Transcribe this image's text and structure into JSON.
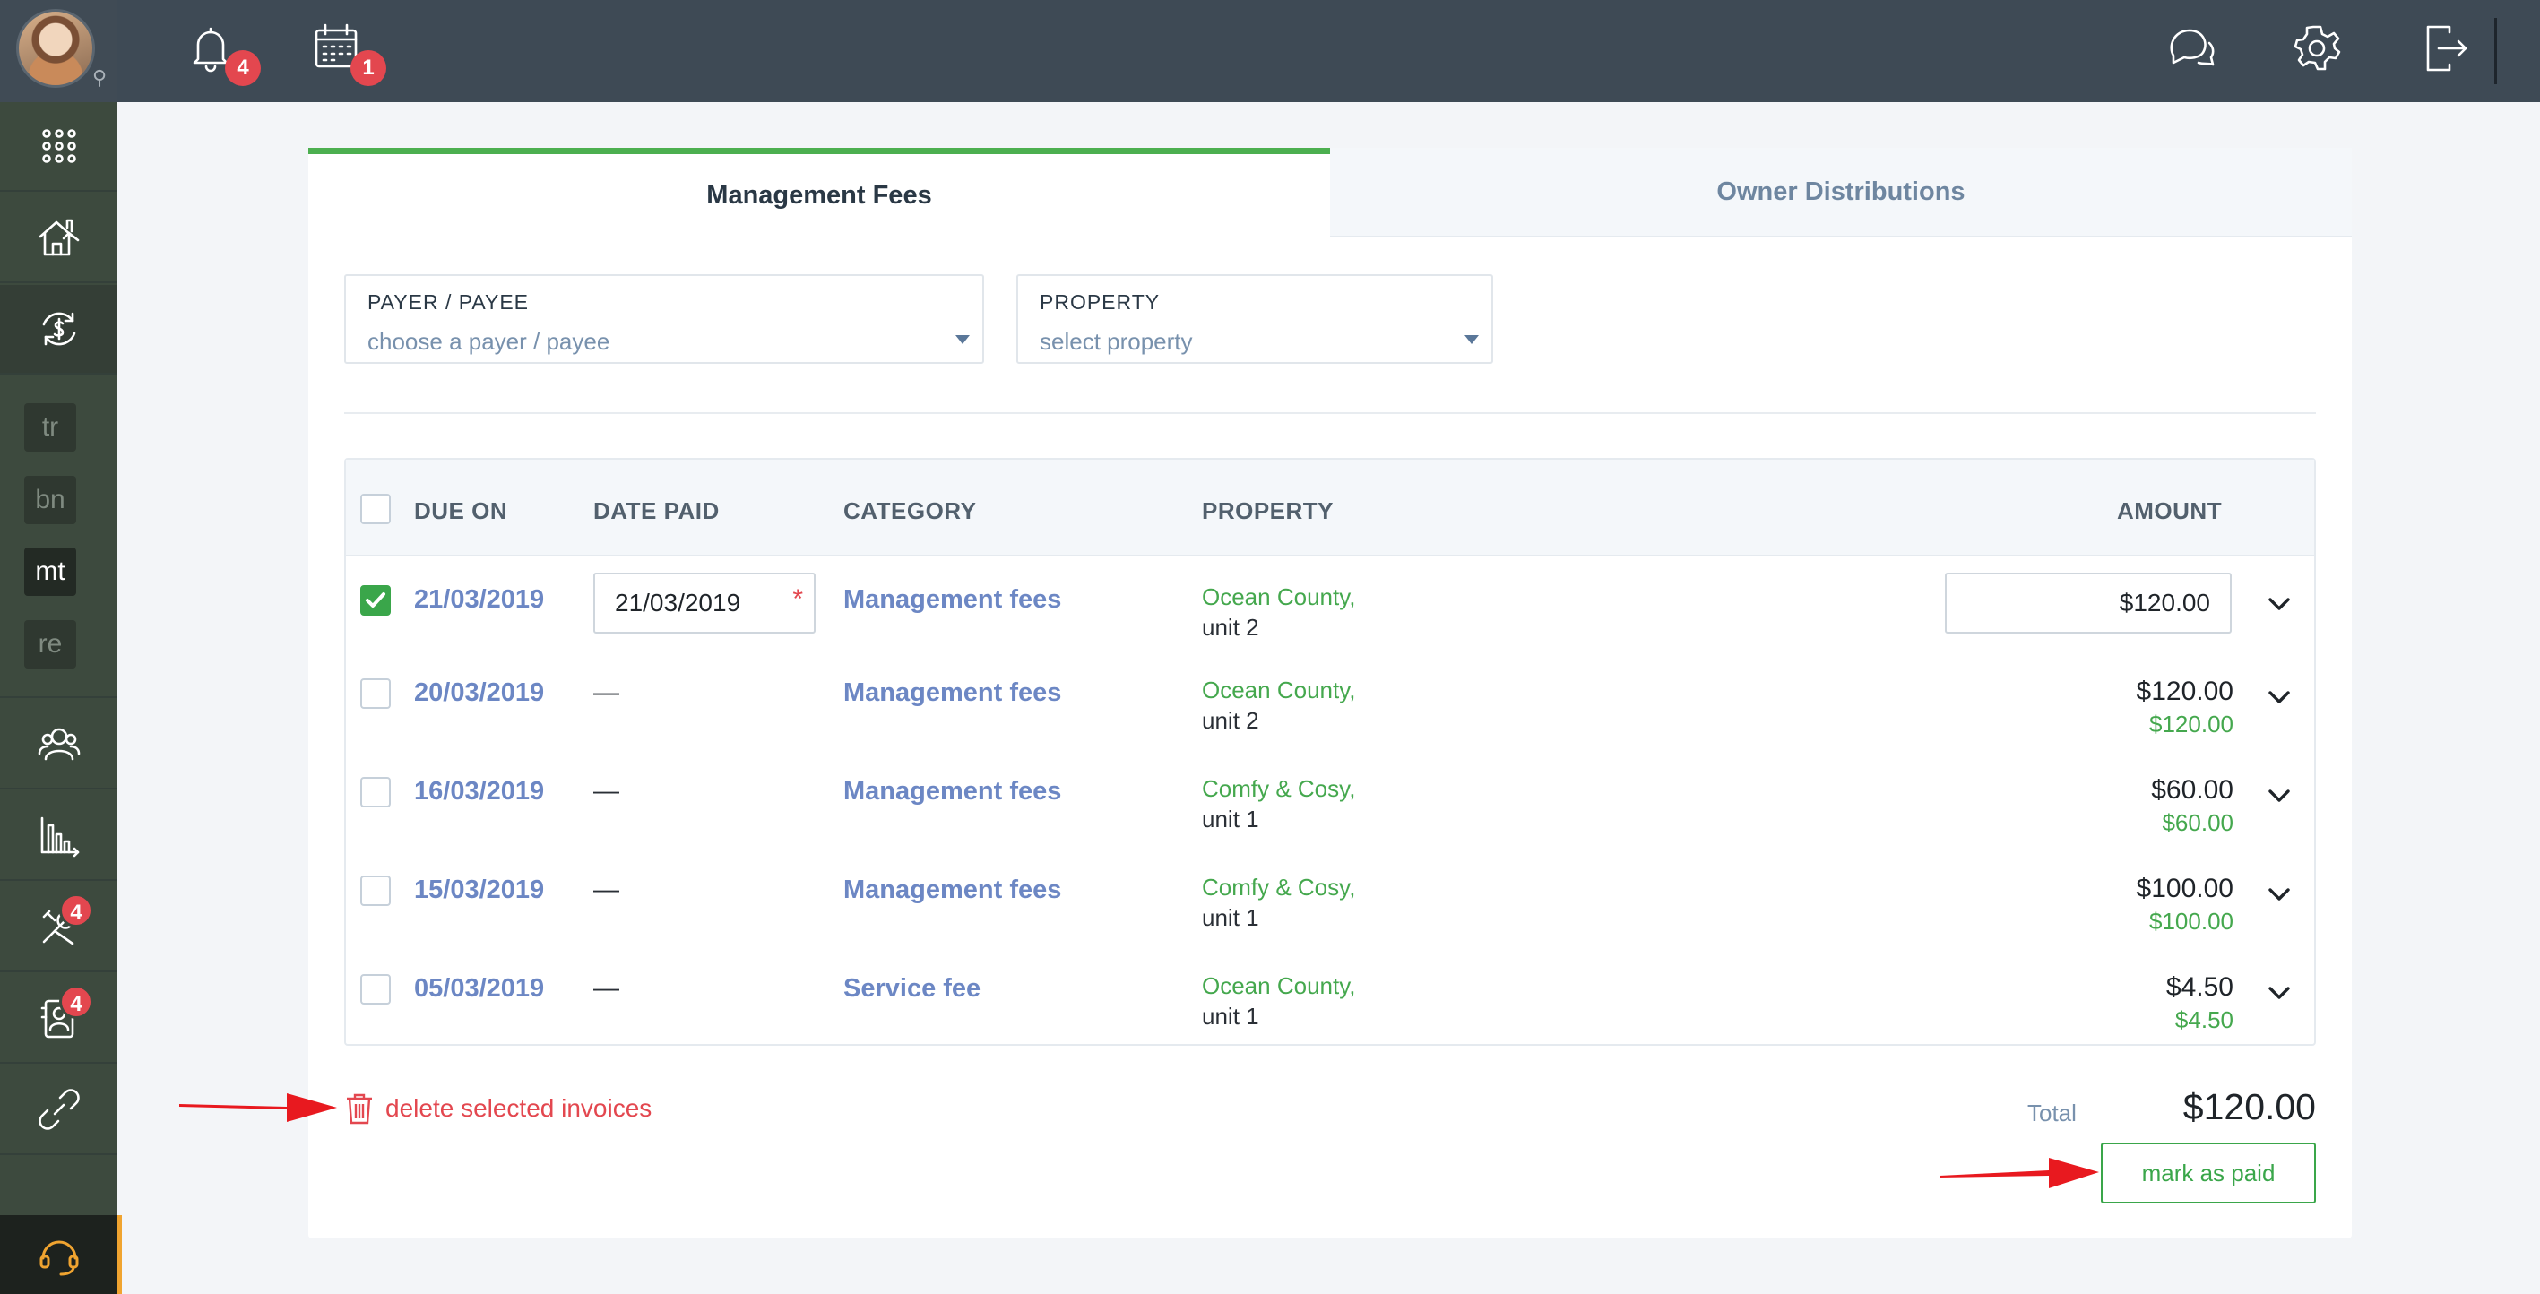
{
  "topbar": {
    "notifications_count": "4",
    "calendar_count": "1"
  },
  "sidebar": {
    "abbreviations": [
      "tr",
      "bn",
      "mt",
      "re"
    ],
    "maintenance_count": "4",
    "tenants_count": "4"
  },
  "tabs": [
    {
      "label": "Management Fees",
      "active": true
    },
    {
      "label": "Owner Distributions",
      "active": false
    }
  ],
  "filters": {
    "payer": {
      "label": "PAYER / PAYEE",
      "placeholder": "choose a payer / payee"
    },
    "property": {
      "label": "PROPERTY",
      "placeholder": "select property"
    }
  },
  "table": {
    "headers": [
      "DUE ON",
      "DATE PAID",
      "CATEGORY",
      "PROPERTY",
      "AMOUNT"
    ],
    "rows": [
      {
        "checked": true,
        "due_on": "21/03/2019",
        "date_paid": "21/03/2019",
        "category": "Management fees",
        "property_line1": "Ocean County,",
        "property_line2": "unit 2",
        "amount": "$120.00",
        "amount_sub": ""
      },
      {
        "checked": false,
        "due_on": "20/03/2019",
        "date_paid": "—",
        "category": "Management fees",
        "property_line1": "Ocean County,",
        "property_line2": "unit 2",
        "amount": "$120.00",
        "amount_sub": "$120.00"
      },
      {
        "checked": false,
        "due_on": "16/03/2019",
        "date_paid": "—",
        "category": "Management fees",
        "property_line1": "Comfy & Cosy,",
        "property_line2": "unit 1",
        "amount": "$60.00",
        "amount_sub": "$60.00"
      },
      {
        "checked": false,
        "due_on": "15/03/2019",
        "date_paid": "—",
        "category": "Management fees",
        "property_line1": "Comfy & Cosy,",
        "property_line2": "unit 1",
        "amount": "$100.00",
        "amount_sub": "$100.00"
      },
      {
        "checked": false,
        "due_on": "05/03/2019",
        "date_paid": "—",
        "category": "Service fee",
        "property_line1": "Ocean County,",
        "property_line2": "unit 1",
        "amount": "$4.50",
        "amount_sub": "$4.50"
      }
    ],
    "required_marker": "*"
  },
  "footer": {
    "delete_label": "delete selected invoices",
    "total_label": "Total",
    "total_value": "$120.00",
    "mark_paid_label": "mark as paid"
  },
  "colors": {
    "accent_green": "#4caf50",
    "link_blue": "#6c87c4",
    "danger_red": "#e3474f",
    "topbar": "#3e4a55",
    "sidebar": "#3d4a3e",
    "annotation_arrow": "#e8191f"
  },
  "icons": [
    "bell-icon",
    "calendar-icon",
    "chat-icon",
    "gear-icon",
    "logout-icon",
    "apps-grid-icon",
    "house-icon",
    "dollar-cycle-icon",
    "people-icon",
    "bar-chart-icon",
    "tools-icon",
    "contact-card-icon",
    "link-icon",
    "headset-icon",
    "trash-icon",
    "chevron-down-icon",
    "pin-icon"
  ]
}
